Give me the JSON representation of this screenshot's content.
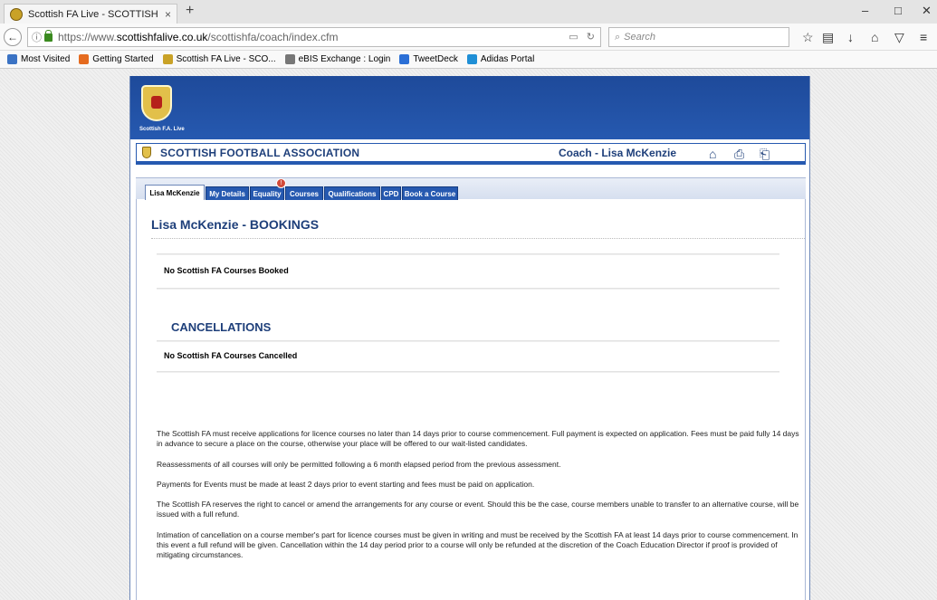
{
  "browser": {
    "tab_title": "Scottish FA Live - SCOTTISH",
    "tab_close": "×",
    "new_tab": "+",
    "url_prefix": "https://www.",
    "url_domain": "scottishfalive.co.uk",
    "url_path": "/scottishfa/coach/index.cfm",
    "search_placeholder": "Search",
    "bookmarks": [
      {
        "label": "Most Visited",
        "color": "#3b73c4"
      },
      {
        "label": "Getting Started",
        "color": "#e56b1f"
      },
      {
        "label": "Scottish FA Live - SCO...",
        "color": "#c9a227"
      },
      {
        "label": "eBIS Exchange : Login",
        "color": "#777777"
      },
      {
        "label": "TweetDeck",
        "color": "#2b6fd6"
      },
      {
        "label": "Adidas Portal",
        "color": "#1f8fd6"
      }
    ]
  },
  "site": {
    "crest_label": "Scottish F.A. Live",
    "org_name": "SCOTTISH FOOTBALL ASSOCIATION",
    "coach_label": "Coach - Lisa McKenzie",
    "tabs": [
      {
        "label": "Lisa McKenzie",
        "active": true
      },
      {
        "label": "My Details",
        "active": false
      },
      {
        "label": "Equality",
        "active": false
      },
      {
        "label": "Courses",
        "active": false
      },
      {
        "label": "Qualifications",
        "active": false
      },
      {
        "label": "CPD",
        "active": false
      },
      {
        "label": "Book a Course",
        "active": false
      }
    ],
    "equality_badge": "!",
    "colors": {
      "brand_blue": "#2659b0",
      "heading_blue": "#1e3f7a"
    }
  },
  "content": {
    "heading": "Lisa McKenzie - BOOKINGS",
    "no_bookings": "No Scottish FA Courses Booked",
    "cancellations_heading": "CANCELLATIONS",
    "no_cancellations": "No Scottish FA Courses Cancelled",
    "terms": [
      "The Scottish FA must receive applications for licence courses no later than 14 days prior to course commencement. Full payment is expected on application. Fees must be paid fully 14 days in advance to secure a place on the course, otherwise your place will be offered to our wait-listed candidates.",
      "Reassessments of all courses will only be permitted following a 6 month elapsed period from the previous assessment.",
      "Payments for Events must be made at least 2 days prior to event starting and fees must be paid on application.",
      "The Scottish FA reserves the right to cancel or amend the arrangements for any course or event. Should this be the case, course members unable to transfer to an alternative course, will be issued with a full refund.",
      "Intimation of cancellation on a course member's part for licence courses must be given in writing and must be received by the Scottish FA at least 14 days prior to course commencement. In this event a full refund will be given. Cancellation within the 14 day period prior to a course will only be refunded at the discretion of the Coach Education Director if proof is provided of mitigating circumstances."
    ]
  }
}
